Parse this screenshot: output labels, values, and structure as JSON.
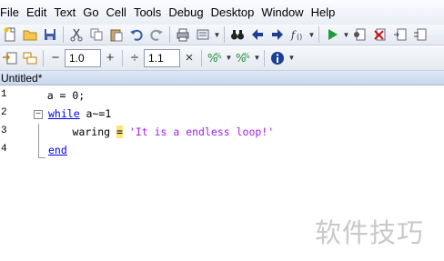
{
  "menu": [
    "File",
    "Edit",
    "Text",
    "Go",
    "Cell",
    "Tools",
    "Debug",
    "Desktop",
    "Window",
    "Help"
  ],
  "toolbar": {
    "cell_decrement": "−",
    "cell_value_1": "1.0",
    "cell_increment": "+",
    "divide": "÷",
    "cell_value_2": "1.1",
    "multiply": "×"
  },
  "tab": {
    "title": "Untitled*"
  },
  "editor": {
    "lines": [
      {
        "num": "1",
        "code": "    a = 0;"
      },
      {
        "num": "2",
        "kw": "while",
        "rest": " a~=1"
      },
      {
        "num": "3",
        "indent": "      waring ",
        "op": "=",
        "space": " ",
        "str": "'It is a endless loop!'"
      },
      {
        "num": "4",
        "kw": "end"
      }
    ]
  },
  "watermark": "软件技巧",
  "colors": {
    "keyword": "#0000ff",
    "string": "#a020f0",
    "highlight": "#ffe27a"
  }
}
